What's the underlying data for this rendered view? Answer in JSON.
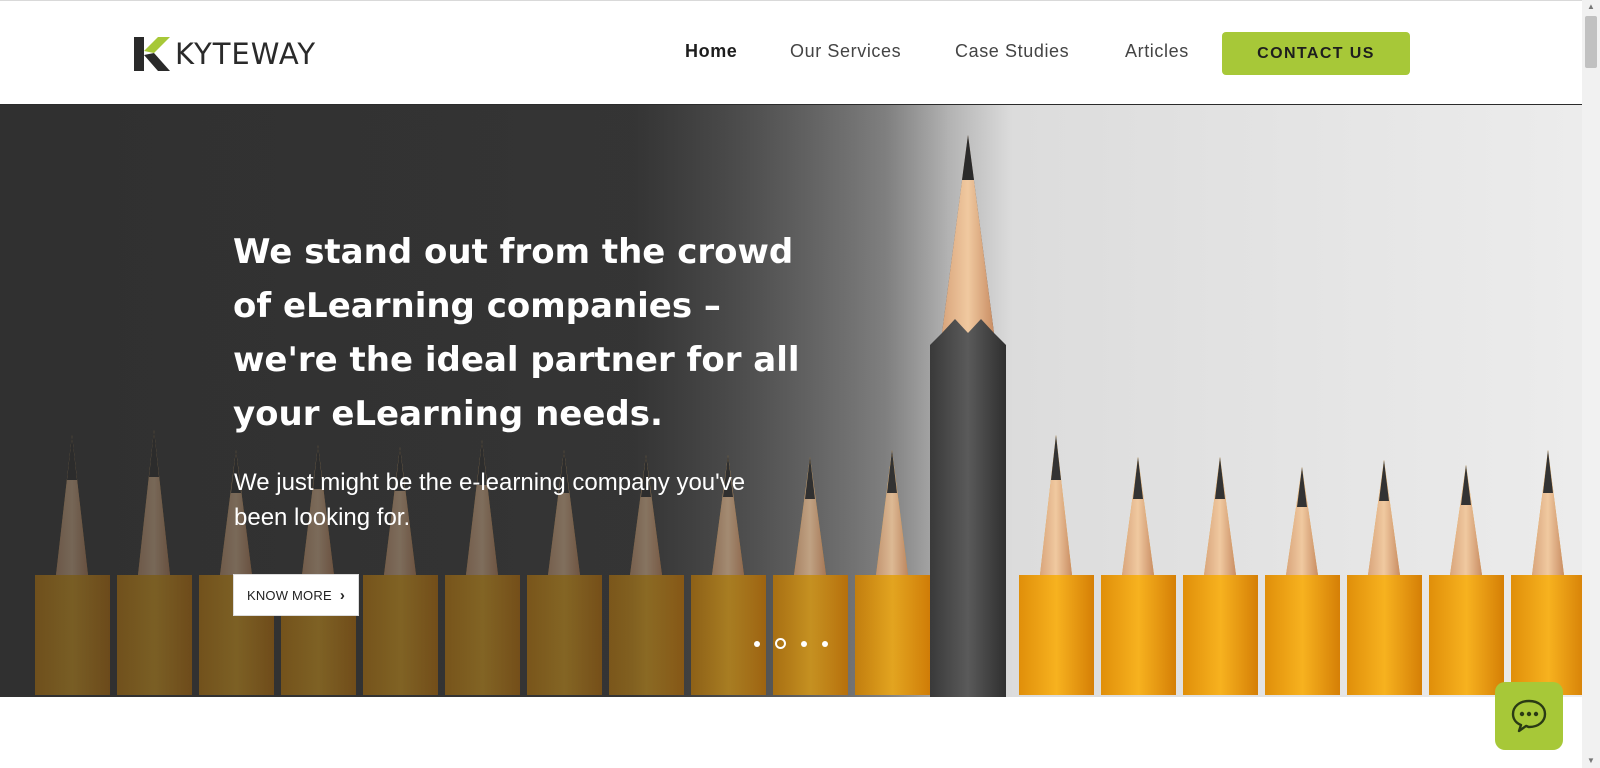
{
  "brand": {
    "name": "KYTEWAY",
    "accent": "#a7c838"
  },
  "nav": {
    "items": [
      {
        "label": "Home",
        "active": true
      },
      {
        "label": "Our Services",
        "active": false
      },
      {
        "label": "Case Studies",
        "active": false
      },
      {
        "label": "Articles",
        "active": false
      }
    ],
    "cta": "CONTACT US"
  },
  "hero": {
    "title": "We stand out from the crowd of eLearning companies – we're the ideal partner for all your eLearning needs.",
    "subtitle": "We just might be the e-learning company you've been looking for.",
    "button": "KNOW MORE",
    "slides": {
      "count": 4,
      "active_index": 1
    }
  },
  "icons": {
    "chat": "chat-bubble-icon",
    "chevron": "chevron-right-icon"
  }
}
